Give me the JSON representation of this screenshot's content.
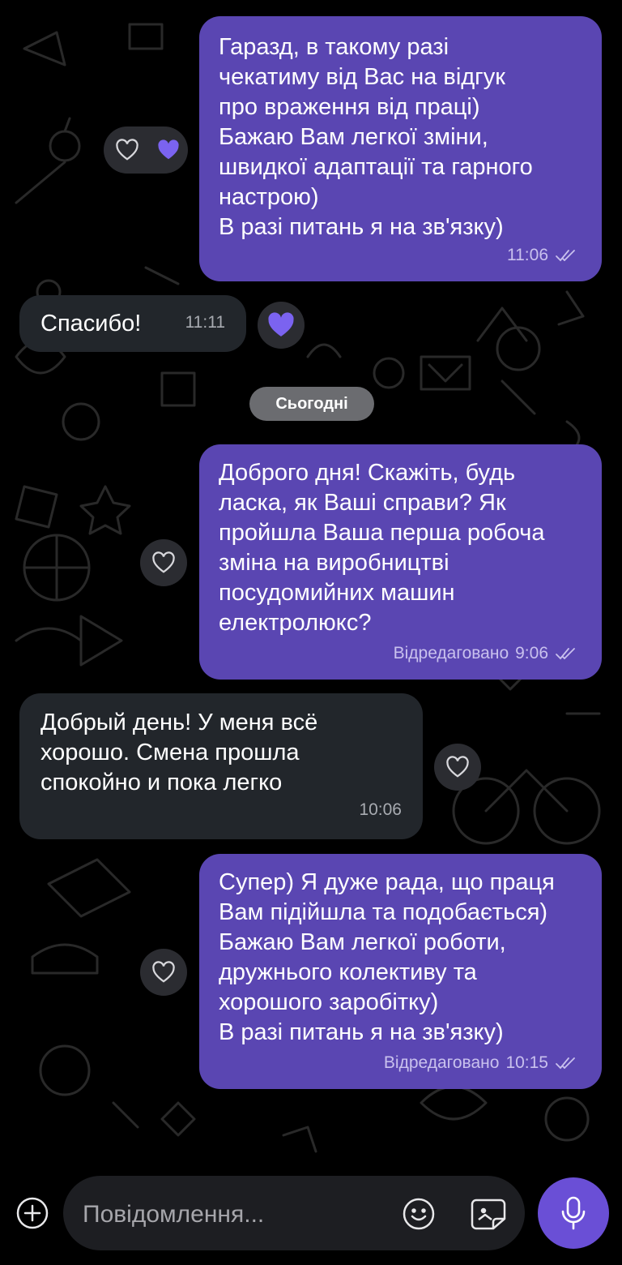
{
  "messages": [
    {
      "direction": "outgoing",
      "text": "Гаразд, в такому разі\nчекатиму від Вас на відгук\nпро враження від праці)\nБажаю Вам легкої зміни,\nшвидкої адаптації та гарного\nнастрою)\nВ разі питань я на зв'язку)",
      "time": "11:06",
      "edited_label": "",
      "status": "read"
    },
    {
      "direction": "incoming",
      "text": "Спасибо!",
      "time": "11:11",
      "edited_label": ""
    },
    {
      "direction": "outgoing",
      "text": "Доброго дня! Скажіть, будь\nласка,  як Ваші справи? Як\nпройшла Ваша перша робоча\nзміна на виробництві\nпосудомийних машин\nелектролюкс?",
      "time": "9:06",
      "edited_label": "Відредаговано",
      "status": "read"
    },
    {
      "direction": "incoming",
      "text": "Добрый день! У меня всё\nхорошо. Смена прошла\nспокойно и пока легко",
      "time": "10:06",
      "edited_label": ""
    },
    {
      "direction": "outgoing",
      "text": "Супер) Я дуже рада, що праця\nВам підійшла та подобається)\nБажаю Вам легкої роботи,\nдружнього колективу та\nхорошого заробітку)\nВ разі питань я на зв'язку)",
      "time": "10:15",
      "edited_label": "Відредаговано",
      "status": "read"
    }
  ],
  "date_separator": "Сьогодні",
  "composer": {
    "placeholder": "Повідомлення..."
  },
  "icons": {
    "add": "plus-circle-icon",
    "emoji": "smiley-icon",
    "sticker": "sticker-icon",
    "mic": "microphone-icon",
    "reaction_empty": "heart-outline-icon",
    "reaction_filled": "heart-filled-icon",
    "read": "double-check-icon"
  },
  "colors": {
    "outgoing_bubble": "#5a46b2",
    "incoming_bubble": "#22262b",
    "accent": "#6a4fd6",
    "background": "#000000"
  }
}
